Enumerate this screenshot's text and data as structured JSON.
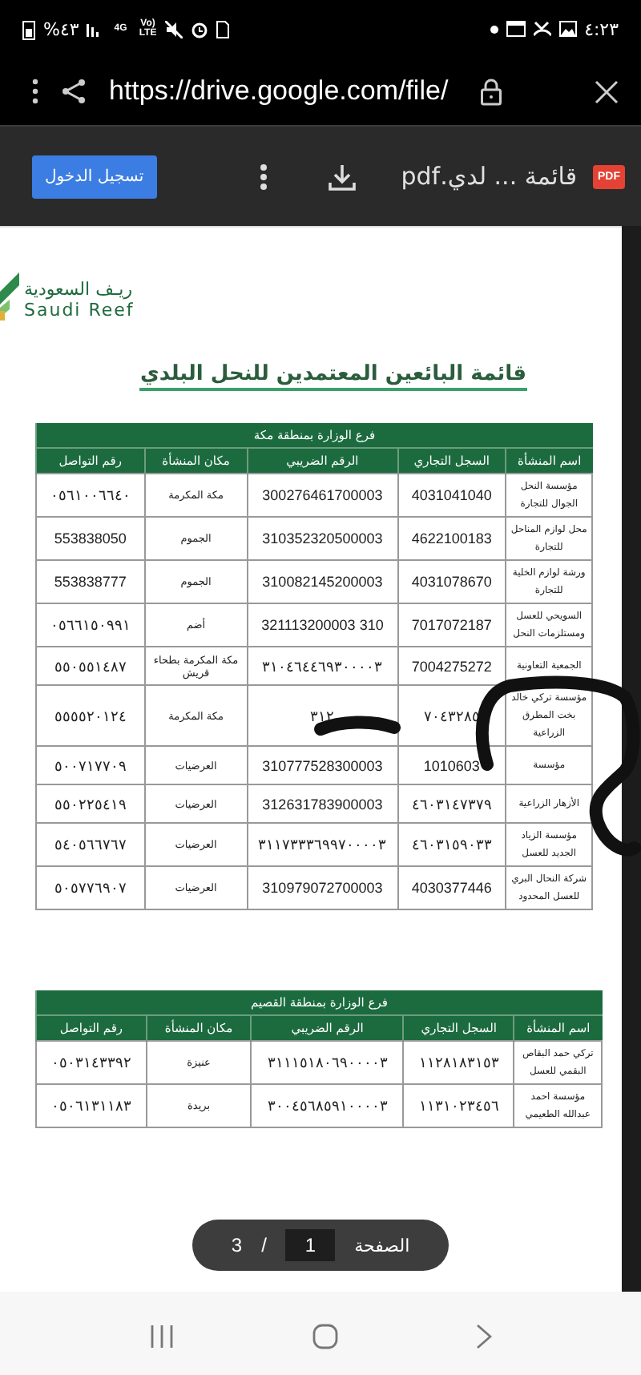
{
  "status_bar": {
    "time": "٤:٢٣",
    "battery": "%٤٣",
    "network": "4G",
    "volte": "Vo) LTE"
  },
  "browser": {
    "url": "https://drive.google.com/file/"
  },
  "toolbar": {
    "file_badge": "PDF",
    "file_name": "قائمة ... لدي.pdf",
    "sign_in": "تسجيل الدخول"
  },
  "document": {
    "logo_ar": "ريـف السعودية",
    "logo_en": "Saudi Reef",
    "title": "قائمة البائعين المعتمدين للنحل البلدي",
    "tables": [
      {
        "region": "فرع الوزارة بمنطقة مكة",
        "columns": [
          "اسم المنشأة",
          "السجل التجاري",
          "الرقم الضريبي",
          "مكان المنشأة",
          "رقم التواصل"
        ],
        "rows": [
          [
            "مؤسسة النحل الجوال للتجارة",
            "4031041040",
            "300276461700003",
            "مكة المكرمة",
            "٠٥٦١٠٠٦٦٤٠"
          ],
          [
            "محل لوازم المناحل للتجارة",
            "4622100183",
            "310352320500003",
            "الجموم",
            "553838050"
          ],
          [
            "ورشة لوازم الخلية للتجارة",
            "4031078670",
            "310082145200003",
            "الجموم",
            "553838777"
          ],
          [
            "السويحي للعسل ومستلزمات النحل",
            "7017072187",
            "310 321113200003",
            "أضم",
            "٠٥٦٦١٥٠٩٩١"
          ],
          [
            "الجمعية التعاونية",
            "7004275272",
            "٣١٠٤٦٤٤٦٩٣٠٠٠٠٣",
            "مكة المكرمة بطحاء قريش",
            "٥٥٠٥٥١٤٨٧"
          ],
          [
            "مؤسسة تركي خالد بخت المطرق الزراعية",
            "٧٠٤٣٢٨٥",
            "٣١٢",
            "مكة المكرمة",
            "٥٥٥٥٢٠١٢٤"
          ],
          [
            "مؤسسة",
            "1010603",
            "310777528300003",
            "العرضيات",
            "٥٠٠٧١٧٧٠٩"
          ],
          [
            "الأزهار الزراعية",
            "٤٦٠٣١٤٧٣٧٩",
            "312631783900003",
            "العرضيات",
            "٥٥٠٢٢٥٤١٩"
          ],
          [
            "مؤسسة الزياد الجديد للعسل",
            "٤٦٠٣١٥٩٠٣٣",
            "٣١١٧٣٣٣٦٩٩٧٠٠٠٠٣",
            "العرضيات",
            "٥٤٠٥٦٦٧٦٧"
          ],
          [
            "شركة النحال البري للعسل المحدود",
            "4030377446",
            "310979072700003",
            "العرضيات",
            "٥٠٥٧٧٦٩٠٧"
          ]
        ]
      },
      {
        "region": "فرع الوزارة بمنطقة القصيم",
        "columns": [
          "اسم المنشأة",
          "السجل التجاري",
          "الرقم الضريبي",
          "مكان المنشأة",
          "رقم التواصل"
        ],
        "rows": [
          [
            "تركي حمد البقاص البقمي للعسل",
            "١١٢٨١٨٣١٥٣",
            "٣١١١٥١٨٠٦٩٠٠٠٠٣",
            "عنيزة",
            "٠٥٠٣١٤٣٣٩٢"
          ],
          [
            "مؤسسة احمد عبدالله الطعيمي",
            "١١٣١٠٢٣٤٥٦",
            "٣٠٠٤٥٦٨٥٩١٠٠٠٠٣",
            "بريدة",
            "٠٥٠٦١٣١١٨٣"
          ]
        ]
      }
    ]
  },
  "page_indicator": {
    "label": "الصفحة",
    "current": "1",
    "separator": "/",
    "total": "3"
  }
}
